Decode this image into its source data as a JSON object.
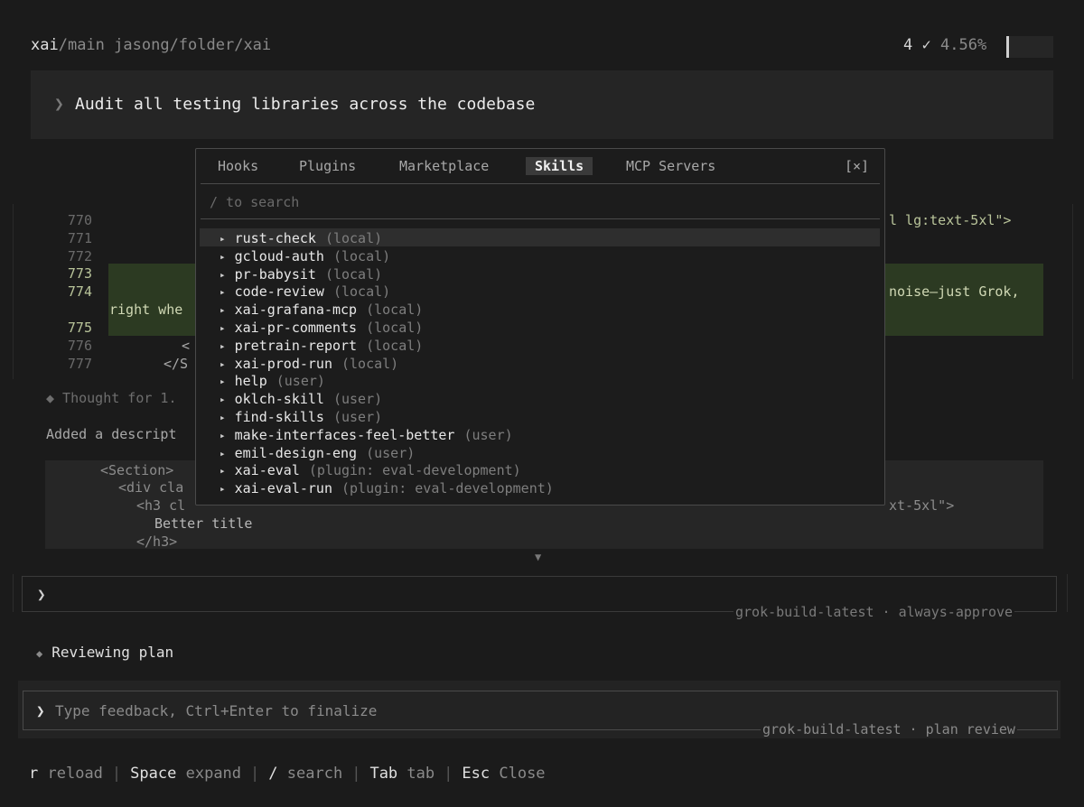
{
  "header": {
    "repo": "xai",
    "branch": "/main",
    "path": "jasong/folder/xai",
    "count": "4",
    "check": "✓",
    "percent": "4.56%"
  },
  "prompt": {
    "chevron": "❯",
    "text": "Audit all testing libraries across the codebase"
  },
  "diff": {
    "line_numbers": [
      "770",
      "771",
      "772",
      "773",
      "774",
      "775",
      "776",
      "777"
    ],
    "right_fragment_770": "l lg:text-5xl\">",
    "right_fragment_774": "noise—just Grok,",
    "left_fragment_775": "right whe",
    "left_fragment_776": "<",
    "left_fragment_777": "</S"
  },
  "thought": "◆ Thought for 1.",
  "added": "Added a descript",
  "snippet": {
    "line1": "<Section>",
    "line2": "<div cla",
    "line3": "<h3 cl",
    "line3_right": "xt-5xl\">",
    "line4": "Better title",
    "line5": "</h3>"
  },
  "scroll_indicator": "▼",
  "input1": {
    "chevron": "❯",
    "model": "grok-build-latest · always-approve"
  },
  "status": {
    "diamond": "◆",
    "text": "Reviewing plan"
  },
  "feedback": {
    "chevron": "❯",
    "placeholder": "Type feedback, Ctrl+Enter to finalize",
    "model": "grok-build-latest · plan review"
  },
  "footer": [
    {
      "key": "r",
      "desc": "reload"
    },
    {
      "key": "Space",
      "desc": "expand"
    },
    {
      "key": "/",
      "desc": "search"
    },
    {
      "key": "Tab",
      "desc": "tab"
    },
    {
      "key": "Esc",
      "desc": "Close"
    }
  ],
  "modal": {
    "tabs": [
      "Hooks",
      "Plugins",
      "Marketplace",
      "Skills",
      "MCP Servers"
    ],
    "active_tab": "Skills",
    "close": "[×]",
    "search_hint": "/ to search",
    "skills": [
      {
        "name": "rust-check",
        "source": "(local)"
      },
      {
        "name": "gcloud-auth",
        "source": "(local)"
      },
      {
        "name": "pr-babysit",
        "source": "(local)"
      },
      {
        "name": "code-review",
        "source": "(local)"
      },
      {
        "name": "xai-grafana-mcp",
        "source": "(local)"
      },
      {
        "name": "xai-pr-comments",
        "source": "(local)"
      },
      {
        "name": "pretrain-report",
        "source": "(local)"
      },
      {
        "name": "xai-prod-run",
        "source": "(local)"
      },
      {
        "name": "help",
        "source": "(user)"
      },
      {
        "name": "oklch-skill",
        "source": "(user)"
      },
      {
        "name": "find-skills",
        "source": "(user)"
      },
      {
        "name": "make-interfaces-feel-better",
        "source": "(user)"
      },
      {
        "name": "emil-design-eng",
        "source": "(user)"
      },
      {
        "name": "xai-eval",
        "source": "(plugin: eval-development)"
      },
      {
        "name": "xai-eval-run",
        "source": "(plugin: eval-development)"
      }
    ],
    "triangle": "▸"
  }
}
